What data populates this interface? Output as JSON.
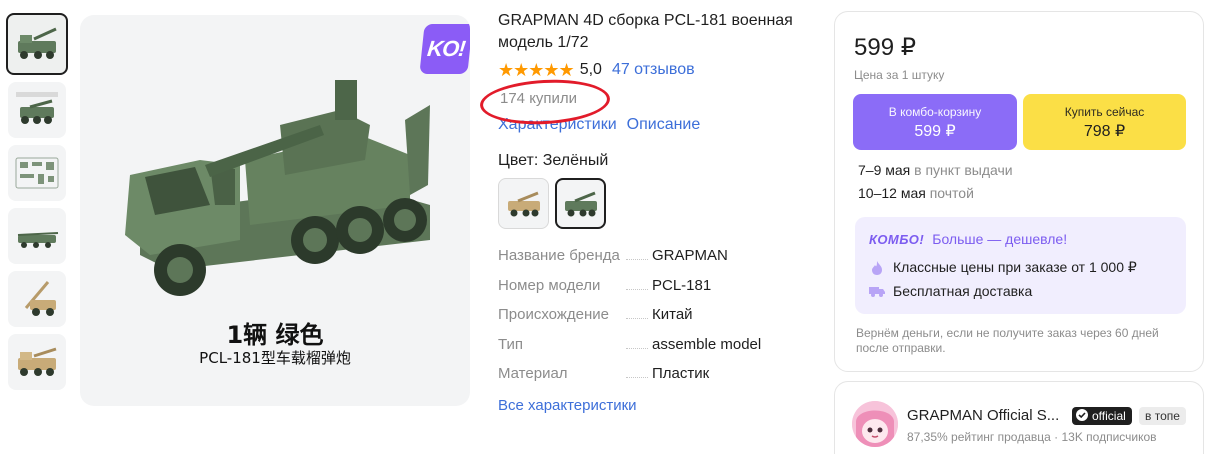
{
  "gallery": {
    "badge_text": "KO!",
    "caption_cn": "1辆 绿色",
    "caption_sub": "PCL-181型车载榴弹炮",
    "thumbnail_count": 6
  },
  "product": {
    "title": "GRAPMAN 4D сборка PCL-181 военная модель 1/72",
    "stars": "★★★★★",
    "rating": "5,0",
    "reviews_link": "47 отзывов",
    "bought": "174 купили",
    "tabs": [
      "Характеристики",
      "Описание"
    ],
    "color_label": "Цвет: Зелёный",
    "specs": [
      {
        "key": "Название бренда",
        "value": "GRAPMAN"
      },
      {
        "key": "Номер модели",
        "value": "PCL-181"
      },
      {
        "key": "Происхождение",
        "value": "Китай"
      },
      {
        "key": "Тип",
        "value": "assemble model"
      },
      {
        "key": "Материал",
        "value": "Пластик"
      }
    ],
    "all_specs_link": "Все характеристики"
  },
  "purchase": {
    "price": "599 ₽",
    "price_note": "Цена за 1 штуку",
    "combo_button": {
      "label": "В комбо-корзину",
      "price": "599 ₽"
    },
    "buy_button": {
      "label": "Купить сейчас",
      "price": "798 ₽"
    },
    "delivery": [
      {
        "dates": "7–9 мая",
        "method": "в пункт выдачи"
      },
      {
        "dates": "10–12 мая",
        "method": "почтой"
      }
    ],
    "combo": {
      "logo": "КОМБО!",
      "tagline": "Больше — дешевле!",
      "lines": [
        "Классные цены при заказе от 1 000 ₽",
        "Бесплатная доставка"
      ]
    },
    "refund_note": "Вернём деньги, если не получите заказ через 60 дней после отправки."
  },
  "seller": {
    "name": "GRAPMAN Official S...",
    "official_badge": "official",
    "top_badge": "в топе",
    "rating_text": "87,35% рейтинг продавца",
    "subscribers": "13K подписчиков"
  },
  "colors": {
    "accent_purple": "#8b6cf7",
    "buy_yellow": "#fbdf46",
    "link_blue": "#3d6fd9",
    "star_orange": "#ff9900",
    "annotation_red": "#e21b2a"
  }
}
